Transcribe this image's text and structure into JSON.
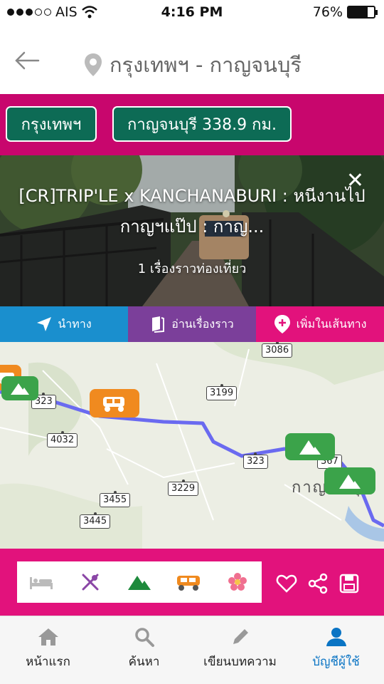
{
  "status_bar": {
    "carrier": "AIS",
    "time": "4:16 PM",
    "battery": "76%",
    "battery_level": 0.76,
    "signal_bars_filled": 3,
    "signal_bars_total": 5
  },
  "header": {
    "back_icon": "back-arrow-icon",
    "location_icon": "location-pin-icon",
    "title": "กรุงเทพฯ - กาญจนบุรี"
  },
  "route": {
    "from_label": "กรุงเทพฯ",
    "to_label": "กาญจนบุรี 338.9 กม.",
    "color": "#c8066d",
    "chip_color": "#0d6b55"
  },
  "hero": {
    "title_line1": "[CR]TRIP'LE x KANCHANABURI : หนีงานไป",
    "title_line2": "กาญฯแป๊ป : กาญ...",
    "subtitle": "1 เรื่องราวท่องเที่ยว",
    "close_label": "✕"
  },
  "actions": {
    "navigate_label": "นำทาง",
    "read_label": "อ่านเรื่องราว",
    "add_label": "เพิ่มในเส้นทาง",
    "colors": {
      "navigate": "#1a8fce",
      "read": "#7b3f9a",
      "add": "#e2127c"
    }
  },
  "map": {
    "highways": [
      "3086",
      "323",
      "3199",
      "4032",
      "323",
      "367",
      "3455",
      "3229",
      "3445"
    ],
    "place_label": "กาญจนบุรี",
    "route_color": "#6a6af0"
  },
  "categories": {
    "items": [
      "bed-icon",
      "utensils-icon",
      "mountain-icon",
      "tuktuk-icon",
      "flower-icon"
    ],
    "side": [
      "heart-icon",
      "share-icon",
      "save-icon"
    ]
  },
  "tabbar": {
    "tabs": [
      {
        "label": "หน้าแรก",
        "icon": "home-icon"
      },
      {
        "label": "ค้นหา",
        "icon": "search-icon"
      },
      {
        "label": "เขียนบทความ",
        "icon": "pencil-icon"
      },
      {
        "label": "บัญชีผู้ใช้",
        "icon": "user-icon"
      }
    ],
    "active_color": "#0a74c4"
  }
}
